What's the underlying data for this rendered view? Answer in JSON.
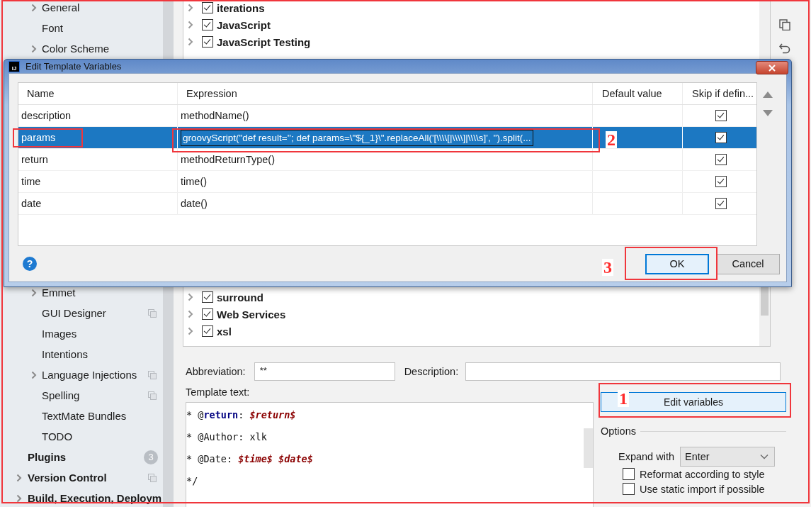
{
  "sidebar": {
    "editor_items_top": [
      {
        "label": "General",
        "expandable": true,
        "shared": false
      },
      {
        "label": "Font",
        "expandable": false,
        "shared": false
      },
      {
        "label": "Color Scheme",
        "expandable": true,
        "shared": false
      }
    ],
    "editor_items_bottom": [
      {
        "label": "Emmet",
        "expandable": true,
        "shared": false
      },
      {
        "label": "GUI Designer",
        "expandable": false,
        "shared": true
      },
      {
        "label": "Images",
        "expandable": false,
        "shared": false
      },
      {
        "label": "Intentions",
        "expandable": false,
        "shared": false
      },
      {
        "label": "Language Injections",
        "expandable": true,
        "shared": true
      },
      {
        "label": "Spelling",
        "expandable": false,
        "shared": true
      },
      {
        "label": "TextMate Bundles",
        "expandable": false,
        "shared": false
      },
      {
        "label": "TODO",
        "expandable": false,
        "shared": false
      }
    ],
    "top_items": [
      {
        "label": "Plugins",
        "expandable": false,
        "shared": false,
        "badge": "3"
      },
      {
        "label": "Version Control",
        "expandable": true,
        "shared": true
      },
      {
        "label": "Build, Execution, Deploym",
        "expandable": true,
        "shared": false
      }
    ]
  },
  "template_groups": {
    "top": [
      {
        "label": "iterations",
        "checked": true
      },
      {
        "label": "JavaScript",
        "checked": true
      },
      {
        "label": "JavaScript Testing",
        "checked": true
      }
    ],
    "bottom": [
      {
        "label": "surround",
        "checked": true
      },
      {
        "label": "Web Services",
        "checked": true
      },
      {
        "label": "xsl",
        "checked": true
      }
    ]
  },
  "dialog": {
    "app_icon": "IJ",
    "title": "Edit Template Variables",
    "columns": [
      "Name",
      "Expression",
      "Default value",
      "Skip if defin..."
    ],
    "rows": [
      {
        "name": "description",
        "expression": "methodName()",
        "skip": true,
        "selected": false
      },
      {
        "name": "params",
        "expression": "groovyScript(\"def result=''; def params=\\\"${_1}\\\".replaceAll('[\\\\\\\\[|\\\\\\\\]|\\\\\\\\s]', '').split(...",
        "skip": true,
        "selected": true
      },
      {
        "name": "return",
        "expression": "methodReturnType()",
        "skip": true,
        "selected": false
      },
      {
        "name": "time",
        "expression": "time()",
        "skip": true,
        "selected": false
      },
      {
        "name": "date",
        "expression": "date()",
        "skip": true,
        "selected": false
      }
    ],
    "help": "?",
    "buttons": [
      {
        "label": "OK",
        "default": true
      },
      {
        "label": "Cancel",
        "default": false
      }
    ]
  },
  "form": {
    "abbreviation_label": "Abbreviation:",
    "abbreviation": "**",
    "description_label": "Description:",
    "template_label": "Template text:",
    "template_lines": [
      [
        {
          "kind": "plain",
          "text": "* @"
        },
        {
          "kind": "tag",
          "text": "return"
        },
        {
          "kind": "plain",
          "text": ": "
        },
        {
          "kind": "var",
          "text": "$return$"
        }
      ],
      [
        {
          "kind": "plain",
          "text": "* @Author: xlk"
        }
      ],
      [
        {
          "kind": "plain",
          "text": "* @Date: "
        },
        {
          "kind": "var",
          "text": "$time$ $date$"
        }
      ],
      [
        {
          "kind": "plain",
          "text": "*/"
        }
      ]
    ],
    "edit_button": "Edit variables",
    "options_title": "Options",
    "expand_label": "Expand with",
    "expand_value": "Enter",
    "options": [
      {
        "label": "Reformat according to style",
        "checked": false
      },
      {
        "label": "Use static import if possible",
        "checked": false
      }
    ]
  },
  "annotations": [
    "1",
    "2",
    "3"
  ]
}
